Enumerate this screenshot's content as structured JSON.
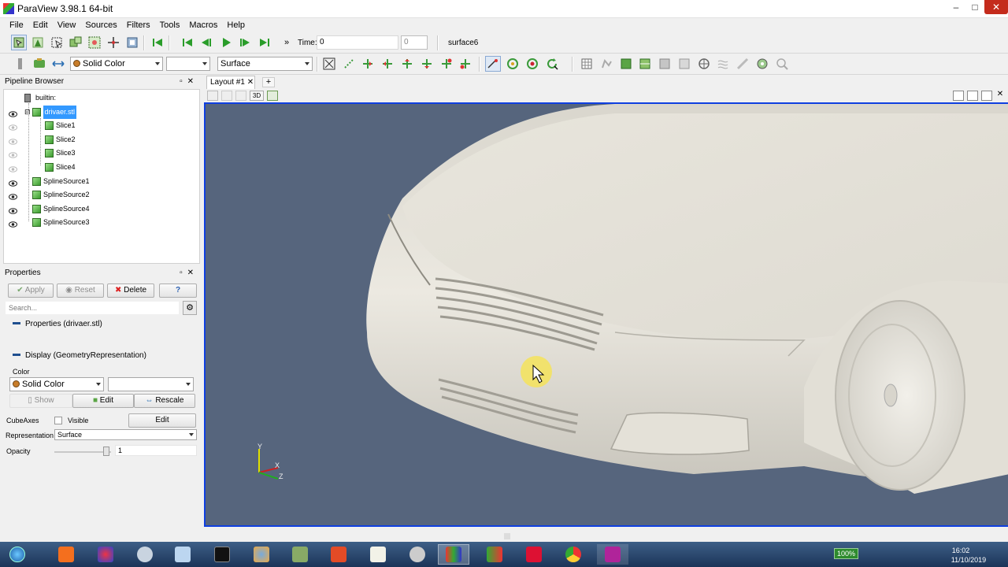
{
  "window": {
    "title": "ParaView 3.98.1 64-bit",
    "controls": [
      "–",
      "□",
      "✕"
    ]
  },
  "menu": [
    "File",
    "Edit",
    "View",
    "Sources",
    "Filters",
    "Tools",
    "Macros",
    "Help"
  ],
  "toolbar": {
    "time_label": "Time:",
    "time_value": "0",
    "time_index": "0",
    "active_source": "surface6",
    "more": "»",
    "color_by": "Solid Color",
    "component": "",
    "representation": "Surface"
  },
  "pipeline": {
    "title": "Pipeline Browser",
    "items": [
      {
        "label": "builtin:",
        "indent": 0,
        "type": "server",
        "visible": false
      },
      {
        "label": "drivaer.stl",
        "indent": 1,
        "type": "source",
        "visible": true,
        "selected": true,
        "expanded": true
      },
      {
        "label": "Slice1",
        "indent": 2,
        "type": "source",
        "visible": false
      },
      {
        "label": "Slice2",
        "indent": 2,
        "type": "source",
        "visible": false
      },
      {
        "label": "Slice3",
        "indent": 2,
        "type": "source",
        "visible": false
      },
      {
        "label": "Slice4",
        "indent": 2,
        "type": "source",
        "visible": false
      },
      {
        "label": "SplineSource1",
        "indent": 1,
        "type": "source",
        "visible": true
      },
      {
        "label": "SplineSource2",
        "indent": 1,
        "type": "source",
        "visible": true
      },
      {
        "label": "SplineSource4",
        "indent": 1,
        "type": "source",
        "visible": true
      },
      {
        "label": "SplineSource3",
        "indent": 1,
        "type": "source",
        "visible": true
      }
    ]
  },
  "properties": {
    "title": "Properties",
    "apply": "Apply",
    "reset": "Reset",
    "delete": "Delete",
    "help": "?",
    "search_placeholder": "Search...",
    "section_props": "Properties (drivaer.stl)",
    "section_display": "Display (GeometryRepresentation)",
    "color_label": "Color",
    "color_value": "Solid Color",
    "color_component": "",
    "show": "Show",
    "edit": "Edit",
    "rescale": "Rescale",
    "cubeaxes_label": "CubeAxes",
    "visible_label": "Visible",
    "cubeaxes_edit": "Edit",
    "representation_label": "Representation",
    "representation_value": "Surface",
    "opacity_label": "Opacity",
    "opacity_value": "1"
  },
  "layout": {
    "tab": "Layout #1",
    "close": "✕",
    "add": "+",
    "mode_3d": "3D"
  },
  "axes": {
    "y": "Y",
    "x": "X",
    "z": "Z"
  },
  "taskbar": {
    "battery": "100%",
    "time": "16:02",
    "date": "11/10/2019"
  },
  "colors": {
    "viewport_bg": "#56657d",
    "selection": "#3399ff",
    "active_view_border": "#0f3fe0",
    "car_body": "#ebe8df"
  }
}
